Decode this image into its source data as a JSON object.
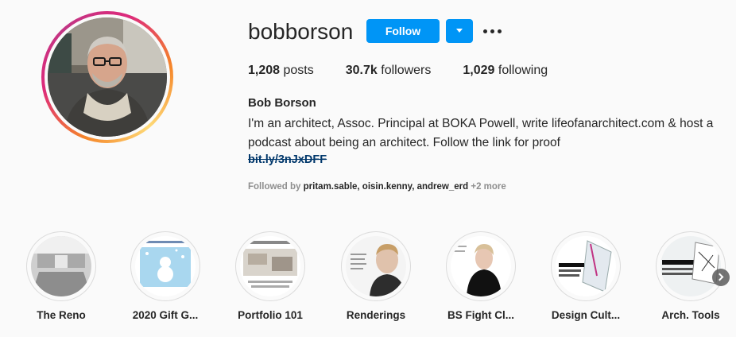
{
  "profile": {
    "username": "bobborson",
    "follow_label": "Follow",
    "full_name": "Bob Borson",
    "bio": "I'm an architect, Assoc. Principal at BOKA Powell, write lifeofanarchitect.com & host a podcast about being an architect. Follow the link for proof",
    "link": "bit.ly/3nJxDFF",
    "accent_color": "#0095f6"
  },
  "stats": {
    "posts_count": "1,208",
    "posts_label": "posts",
    "followers_count": "30.7k",
    "followers_label": "followers",
    "following_count": "1,029",
    "following_label": "following"
  },
  "followed_by": {
    "prefix": "Followed by",
    "names": "pritam.sable, oisin.kenny, andrew_erd",
    "more": "+2 more"
  },
  "highlights": [
    {
      "label": "The Reno"
    },
    {
      "label": "2020 Gift G..."
    },
    {
      "label": "Portfolio 101"
    },
    {
      "label": "Renderings"
    },
    {
      "label": "BS Fight Cl..."
    },
    {
      "label": "Design Cult..."
    },
    {
      "label": "Arch. Tools"
    }
  ]
}
